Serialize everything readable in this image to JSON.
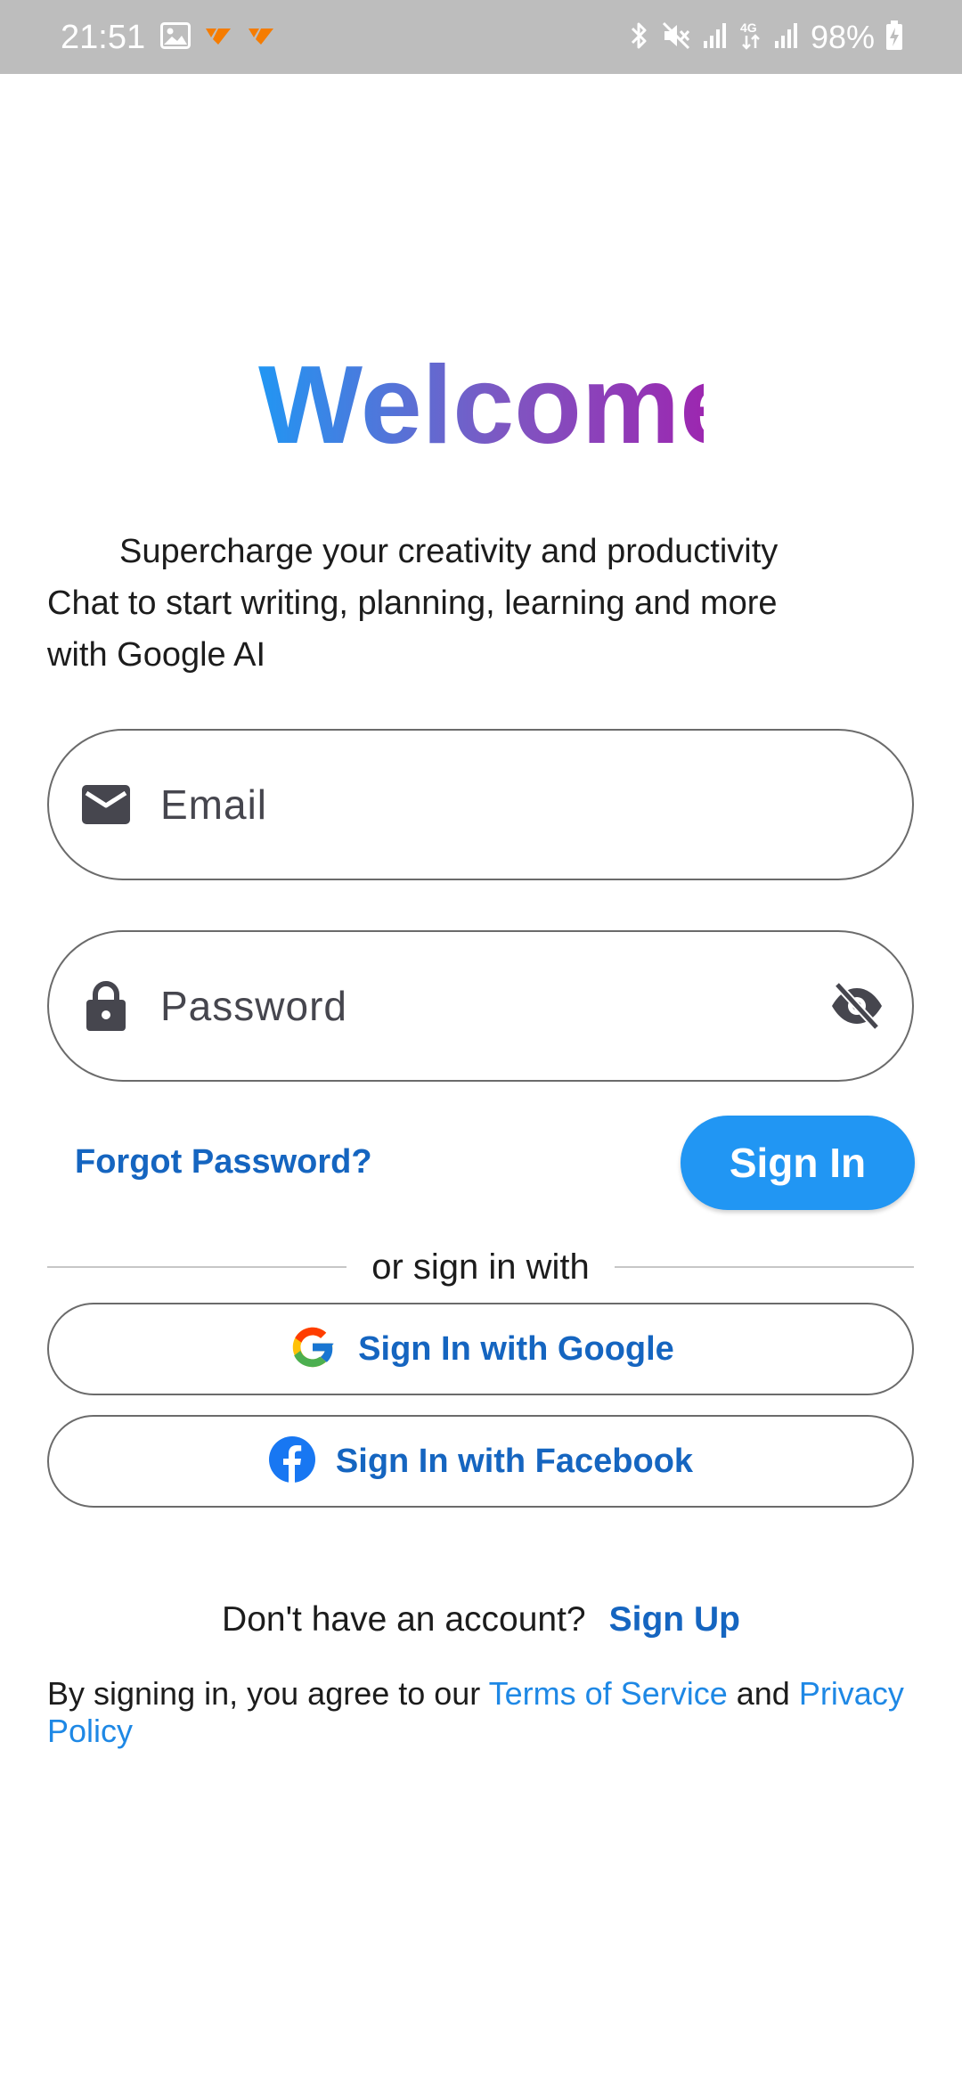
{
  "status_bar": {
    "time": "21:51",
    "battery_percent": "98%",
    "network_label": "4G",
    "left_icons": [
      "gallery-icon",
      "app-notification-icon",
      "app-notification-icon"
    ],
    "right_icons": [
      "bluetooth-icon",
      "mute-icon",
      "signal-icon",
      "data-4g-icon",
      "signal-icon",
      "battery-charging-icon"
    ]
  },
  "header": {
    "title": "Welcome"
  },
  "subtitle": {
    "line1": "Supercharge your creativity and productivity",
    "line2": "Chat to start writing, planning, learning and more",
    "line3": "with Google AI"
  },
  "form": {
    "email_placeholder": "Email",
    "email_value": "",
    "password_placeholder": "Password",
    "password_value": "",
    "forgot_label": "Forgot Password?",
    "signin_label": "Sign In"
  },
  "divider": {
    "text": "or sign in with"
  },
  "social": {
    "google_label": "Sign In with Google",
    "facebook_label": "Sign In with Facebook"
  },
  "signup": {
    "question": "Don't have an account?",
    "link": "Sign Up"
  },
  "terms": {
    "prefix": "By signing in, you agree to our ",
    "tos": "Terms of Service",
    "and": " and ",
    "privacy": "Privacy Policy"
  },
  "colors": {
    "accent": "#2196f3",
    "link": "#1565c0",
    "gradient_start": "#2196f3",
    "gradient_end": "#9c27b0",
    "facebook": "#1877f2"
  }
}
